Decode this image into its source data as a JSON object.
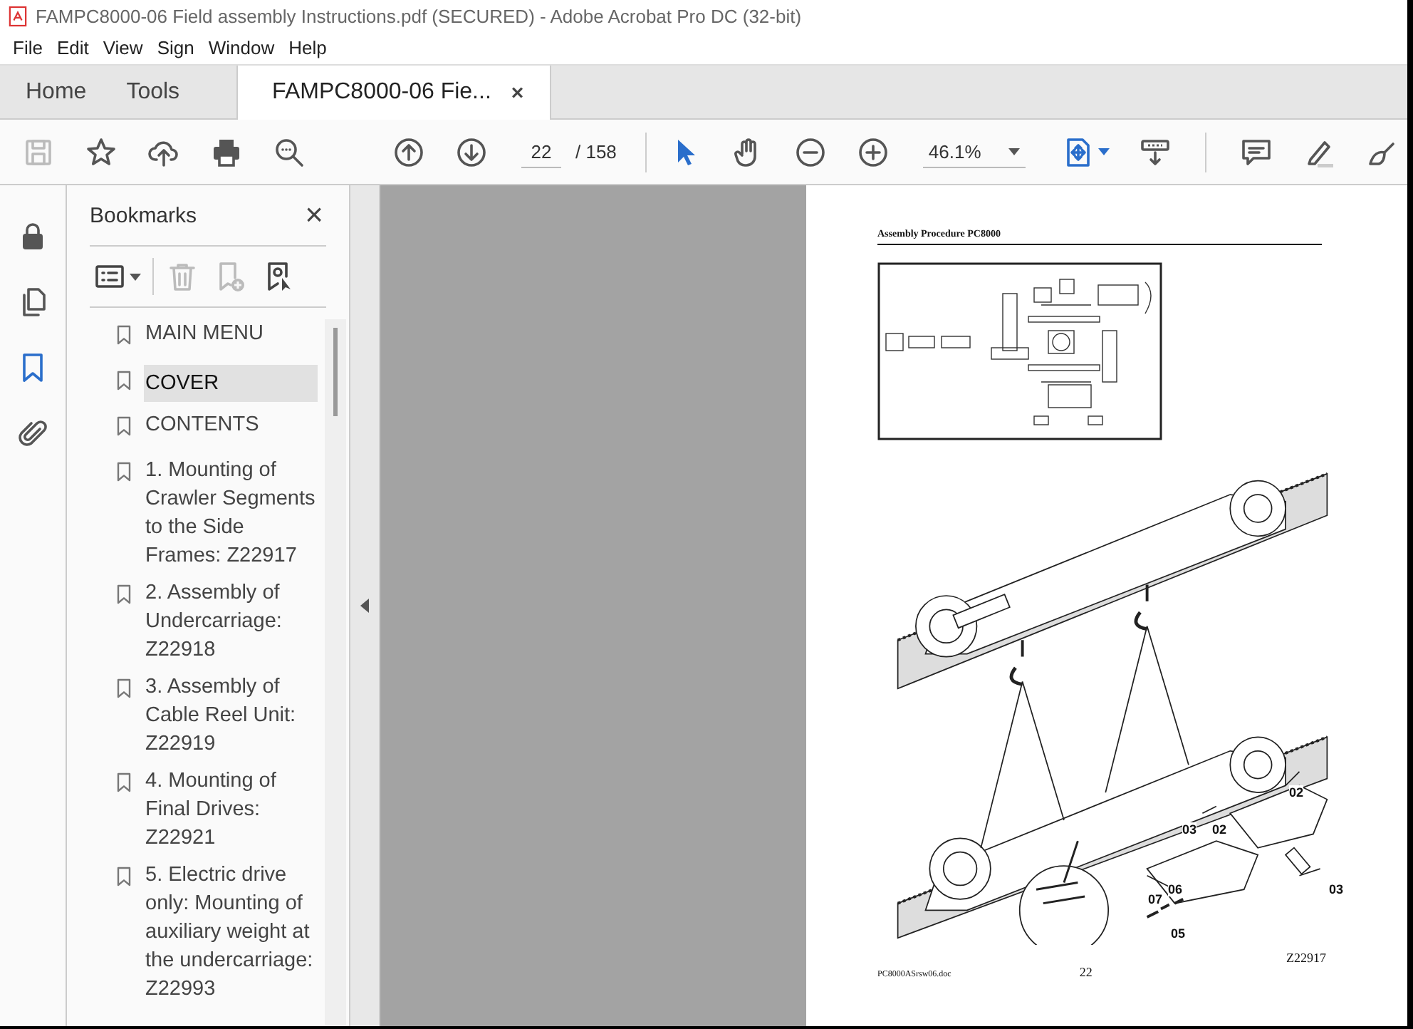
{
  "window": {
    "title": "FAMPC8000-06 Field assembly Instructions.pdf (SECURED) - Adobe Acrobat Pro DC (32-bit)"
  },
  "menu": [
    "File",
    "Edit",
    "View",
    "Sign",
    "Window",
    "Help"
  ],
  "tabs": [
    {
      "label": "Home",
      "selected": false
    },
    {
      "label": "Tools",
      "selected": false
    },
    {
      "label": "FAMPC8000-06 Fie...",
      "selected": true,
      "close": "×"
    }
  ],
  "toolbar": {
    "left_tools": [
      {
        "kind": "save",
        "disabled": true
      },
      {
        "kind": "star",
        "disabled": false
      },
      {
        "kind": "upload",
        "disabled": false
      },
      {
        "kind": "print",
        "disabled": false
      },
      {
        "kind": "find",
        "disabled": false
      }
    ],
    "nav_tools": [
      {
        "kind": "up",
        "disabled": false
      },
      {
        "kind": "down",
        "disabled": false
      }
    ],
    "page": "22",
    "page_total": "/ 158",
    "view_tools": [
      {
        "kind": "select",
        "selected": true
      },
      {
        "kind": "hand",
        "selected": false
      },
      {
        "kind": "minus",
        "selected": false
      },
      {
        "kind": "plus",
        "selected": false
      }
    ],
    "zoom": "46.1%",
    "right_tools": [
      {
        "kind": "fit",
        "selected": true
      },
      {
        "kind": "scroll",
        "selected": false
      },
      {
        "kind": "comment",
        "selected": false
      },
      {
        "kind": "highlight",
        "selected": false
      },
      {
        "kind": "sign",
        "selected": false
      }
    ]
  },
  "rail": [
    {
      "kind": "lock",
      "selected": false
    },
    {
      "kind": "pages",
      "selected": false
    },
    {
      "kind": "bookmark",
      "selected": true
    },
    {
      "kind": "clip",
      "selected": false
    }
  ],
  "bookmarks": {
    "title": "Bookmarks",
    "close": "×",
    "tools": [
      {
        "kind": "options",
        "disabled": false
      },
      {
        "kind": "trash",
        "disabled": true
      },
      {
        "kind": "addbm",
        "disabled": true
      },
      {
        "kind": "findbm",
        "disabled": false
      }
    ],
    "items": [
      {
        "label": "MAIN MENU",
        "selected": false
      },
      {
        "label": "COVER",
        "selected": true
      },
      {
        "label": "CONTENTS",
        "selected": false
      },
      {
        "label": "1. Mounting of Crawler Segments to the Side Frames: Z22917",
        "selected": false
      },
      {
        "label": "2. Assembly of Undercarriage: Z22918",
        "selected": false
      },
      {
        "label": "3. Assembly of Cable Reel Unit: Z22919",
        "selected": false
      },
      {
        "label": "4. Mounting of Final Drives: Z22921",
        "selected": false
      },
      {
        "label": "5. Electric drive only:  Mounting of auxiliary weight at the undercarriage: Z22993",
        "selected": false
      }
    ]
  },
  "page": {
    "header": "Assembly Procedure PC8000",
    "callouts": [
      "02",
      "03",
      "02",
      "03",
      "06",
      "07",
      "05"
    ],
    "footer_file": "PC8000ASrsw06.doc",
    "page_number": "22",
    "drawing_number": "Z22917"
  }
}
